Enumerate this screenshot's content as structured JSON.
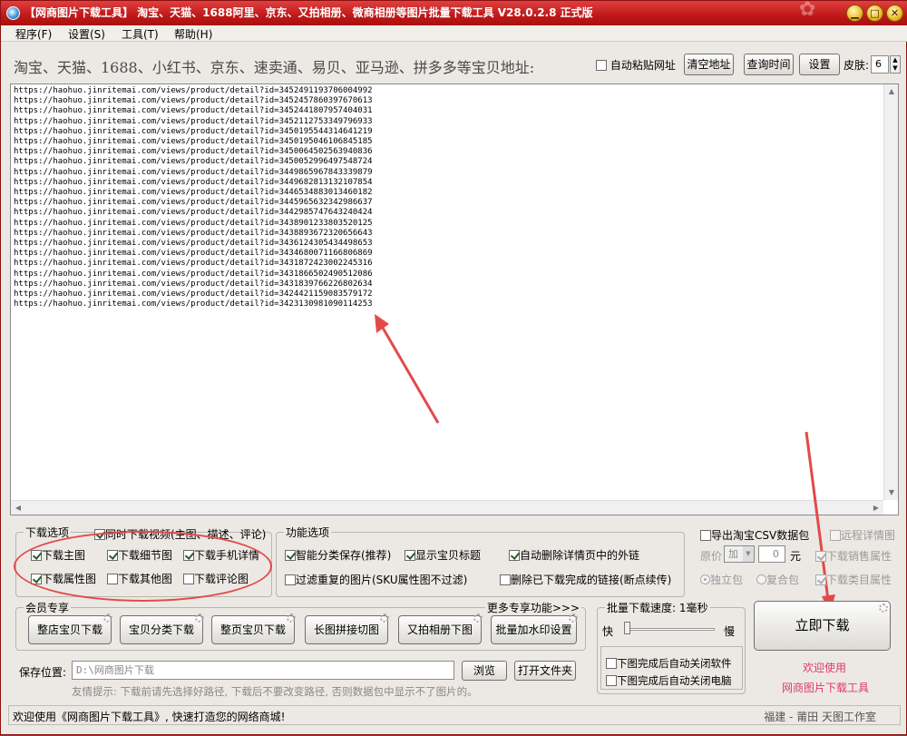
{
  "title": "【网商图片下载工具】 淘宝、天猫、1688阿里、京东、又拍相册、微商相册等图片批量下载工具 V28.0.2.8 正式版",
  "window_buttons": {
    "minimize": "▁",
    "maximize": "□",
    "close": "✕"
  },
  "menu": [
    "程序(F)",
    "设置(S)",
    "工具(T)",
    "帮助(H)"
  ],
  "top": {
    "label": "淘宝、天猫、1688、小红书、京东、速卖通、易贝、亚马逊、拼多多等宝贝地址:",
    "auto_paste": "自动粘贴网址",
    "clear_btn": "清空地址",
    "query_btn": "查询时间",
    "settings_btn": "设置",
    "skin_label": "皮肤:",
    "skin_value": "6"
  },
  "urls": [
    "https://haohuo.jinritemai.com/views/product/detail?id=3452491193706004992",
    "https://haohuo.jinritemai.com/views/product/detail?id=3452457860397670613",
    "https://haohuo.jinritemai.com/views/product/detail?id=3452441807957404031",
    "https://haohuo.jinritemai.com/views/product/detail?id=3452112753349796933",
    "https://haohuo.jinritemai.com/views/product/detail?id=3450195544314641219",
    "https://haohuo.jinritemai.com/views/product/detail?id=3450195046106845185",
    "https://haohuo.jinritemai.com/views/product/detail?id=3450064502563940836",
    "https://haohuo.jinritemai.com/views/product/detail?id=3450052996497548724",
    "https://haohuo.jinritemai.com/views/product/detail?id=3449865967843339879",
    "https://haohuo.jinritemai.com/views/product/detail?id=3449682813132107854",
    "https://haohuo.jinritemai.com/views/product/detail?id=3446534883013460182",
    "https://haohuo.jinritemai.com/views/product/detail?id=3445965632342986637",
    "https://haohuo.jinritemai.com/views/product/detail?id=3442985747643240424",
    "https://haohuo.jinritemai.com/views/product/detail?id=3438901233803520125",
    "https://haohuo.jinritemai.com/views/product/detail?id=3438893672320656643",
    "https://haohuo.jinritemai.com/views/product/detail?id=3436124305434498653",
    "https://haohuo.jinritemai.com/views/product/detail?id=3434680071166806869",
    "https://haohuo.jinritemai.com/views/product/detail?id=3431872423002245316",
    "https://haohuo.jinritemai.com/views/product/detail?id=3431866502490512086",
    "https://haohuo.jinritemai.com/views/product/detail?id=3431839766226802634",
    "https://haohuo.jinritemai.com/views/product/detail?id=3424421159083579172",
    "https://haohuo.jinritemai.com/views/product/detail?id=3423130981090114253"
  ],
  "download_options": {
    "title": "下载选项",
    "video": "同时下载视频(主图、描述、评论)",
    "main_img": "下载主图",
    "detail_img": "下载细节图",
    "mobile_detail": "下载手机详情",
    "attr_img": "下载属性图",
    "other_img": "下载其他图",
    "review_img": "下载评论图"
  },
  "function_options": {
    "title": "功能选项",
    "smart_save": "智能分类保存(推荐)",
    "show_title": "显示宝贝标题",
    "auto_delete_links": "自动删除详情页中的外链",
    "filter_dup": "过滤重复的图片(SKU属性图不过滤)",
    "delete_downloaded": "删除已下载完成的链接(断点续传)"
  },
  "right_options": {
    "export_csv": "导出淘宝CSV数据包",
    "remote_detail": "远程详情图",
    "price_label": "原价",
    "price_op": "加",
    "price_value": "0",
    "price_unit": "元",
    "sales_attr": "下载销售属性",
    "standalone": "独立包",
    "combined": "复合包",
    "category_attr": "下载类目属性"
  },
  "member": {
    "title": "会员专享",
    "more": "更多专享功能>>>",
    "buttons": [
      "整店宝贝下载",
      "宝贝分类下载",
      "整页宝贝下载",
      "长图拼接切图",
      "又拍相册下图",
      "批量加水印设置"
    ]
  },
  "speed": {
    "title": "批量下载速度: 1毫秒",
    "fast": "快",
    "slow": "慢",
    "close_app": "下图完成后自动关闭软件",
    "shutdown": "下图完成后自动关闭电脑",
    "level": 0
  },
  "download_now": "立即下载",
  "welcome1": "欢迎使用",
  "welcome2": "网商图片下载工具",
  "save": {
    "label": "保存位置:",
    "path": "D:\\网商图片下载",
    "browse": "浏览",
    "open_folder": "打开文件夹",
    "hint": "友情提示: 下载前请先选择好路径, 下载后不要改变路径, 否则数据包中显示不了图片的。"
  },
  "status": {
    "left": "欢迎使用《网商图片下载工具》, 快速打造您的网络商城!",
    "right": "福建 - 莆田  天图工作室"
  },
  "colors": {
    "accent_red": "#e24a4a",
    "title_red": "#c62424",
    "welcome": "#e0386b"
  }
}
